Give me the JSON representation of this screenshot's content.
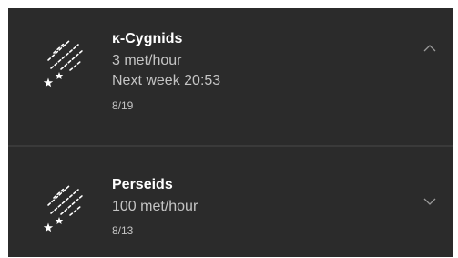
{
  "showers": [
    {
      "name": "κ-Cygnids",
      "rate": "3 met/hour",
      "next_peak": "Next week 20:53",
      "date": "8/19",
      "icon": "meteor-shower-icon",
      "toggle_icon": "chevron-up-icon",
      "expanded": true
    },
    {
      "name": "Perseids",
      "rate": "100 met/hour",
      "date": "8/13",
      "icon": "meteor-shower-icon",
      "toggle_icon": "chevron-down-icon",
      "expanded": false
    }
  ],
  "colors": {
    "background": "#2b2b2b",
    "divider": "#3a3a3a",
    "title": "#ffffff",
    "secondary_text": "#c4c4c4",
    "chevron": "#9a9a9a"
  }
}
